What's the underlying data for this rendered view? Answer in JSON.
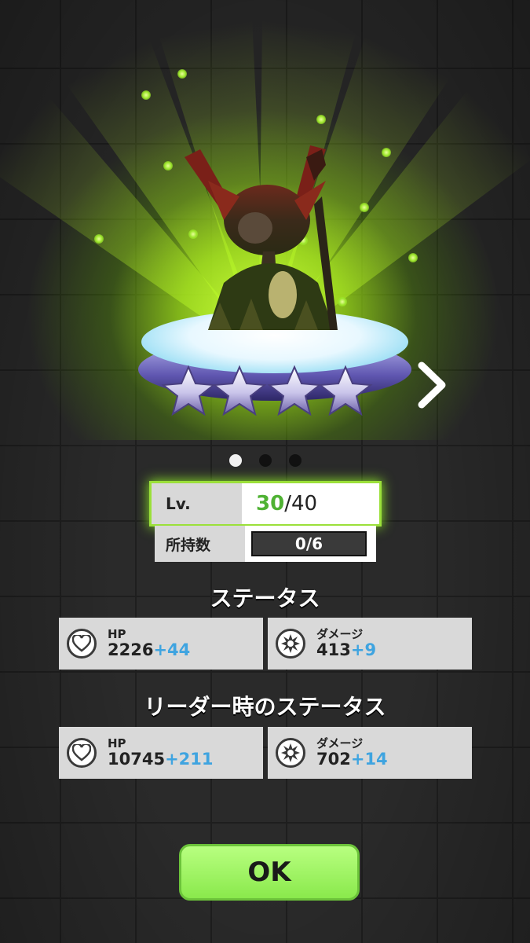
{
  "level": {
    "label": "Lv.",
    "current": "30",
    "max": "/40"
  },
  "owned": {
    "label": "所持数",
    "value": "0/6"
  },
  "rarity_stars": 4,
  "pager": {
    "pages": 3,
    "active_index": 0
  },
  "status": {
    "title": "ステータス",
    "hp": {
      "name": "HP",
      "value": "2226",
      "bonus": "+44"
    },
    "damage": {
      "name": "ダメージ",
      "value": "413",
      "bonus": "+9"
    }
  },
  "leader_status": {
    "title": "リーダー時のステータス",
    "hp": {
      "name": "HP",
      "value": "10745",
      "bonus": "+211"
    },
    "damage": {
      "name": "ダメージ",
      "value": "702",
      "bonus": "+14"
    }
  },
  "ok_label": "OK",
  "colors": {
    "glow": "#9be03a",
    "bonus": "#3fa4e0",
    "level_current": "#4fb233",
    "ok_button": "#8ae94c"
  }
}
